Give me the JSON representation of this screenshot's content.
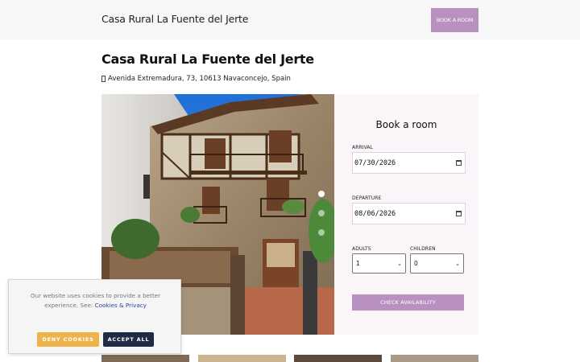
{
  "header": {
    "brand": "Casa Rural La Fuente del Jerte",
    "book_button": "BOOK A ROOM"
  },
  "property": {
    "title": "Casa Rural La Fuente del Jerte",
    "address": "Avenida Extremadura, 73, 10613 Navaconcejo, Spain",
    "address_icon": "map-pin-icon"
  },
  "gallery": {
    "slide_count": 3,
    "active_slide": 1
  },
  "booking": {
    "title": "Book a room",
    "arrival_label": "ARRIVAL",
    "arrival_value": "07/30/2026",
    "departure_label": "DEPARTURE",
    "departure_value": "08/06/2026",
    "adults_label": "ADULTS",
    "adults_value": "1",
    "children_label": "CHILDREN",
    "children_value": "0",
    "check_button": "CHECK AVAILABILITY"
  },
  "cookie_banner": {
    "text": "Our website uses cookies to provide a better experience. See:",
    "link": "Cookies & Privacy",
    "deny_button": "DENY COOKIES",
    "accept_button": "ACCEPT ALL"
  },
  "colors": {
    "accent": "#b891c0",
    "topbar": "#f7f7f7",
    "booking_panel": "#f9f5f8",
    "deny": "#f0b24a",
    "accept": "#1f2a44"
  }
}
